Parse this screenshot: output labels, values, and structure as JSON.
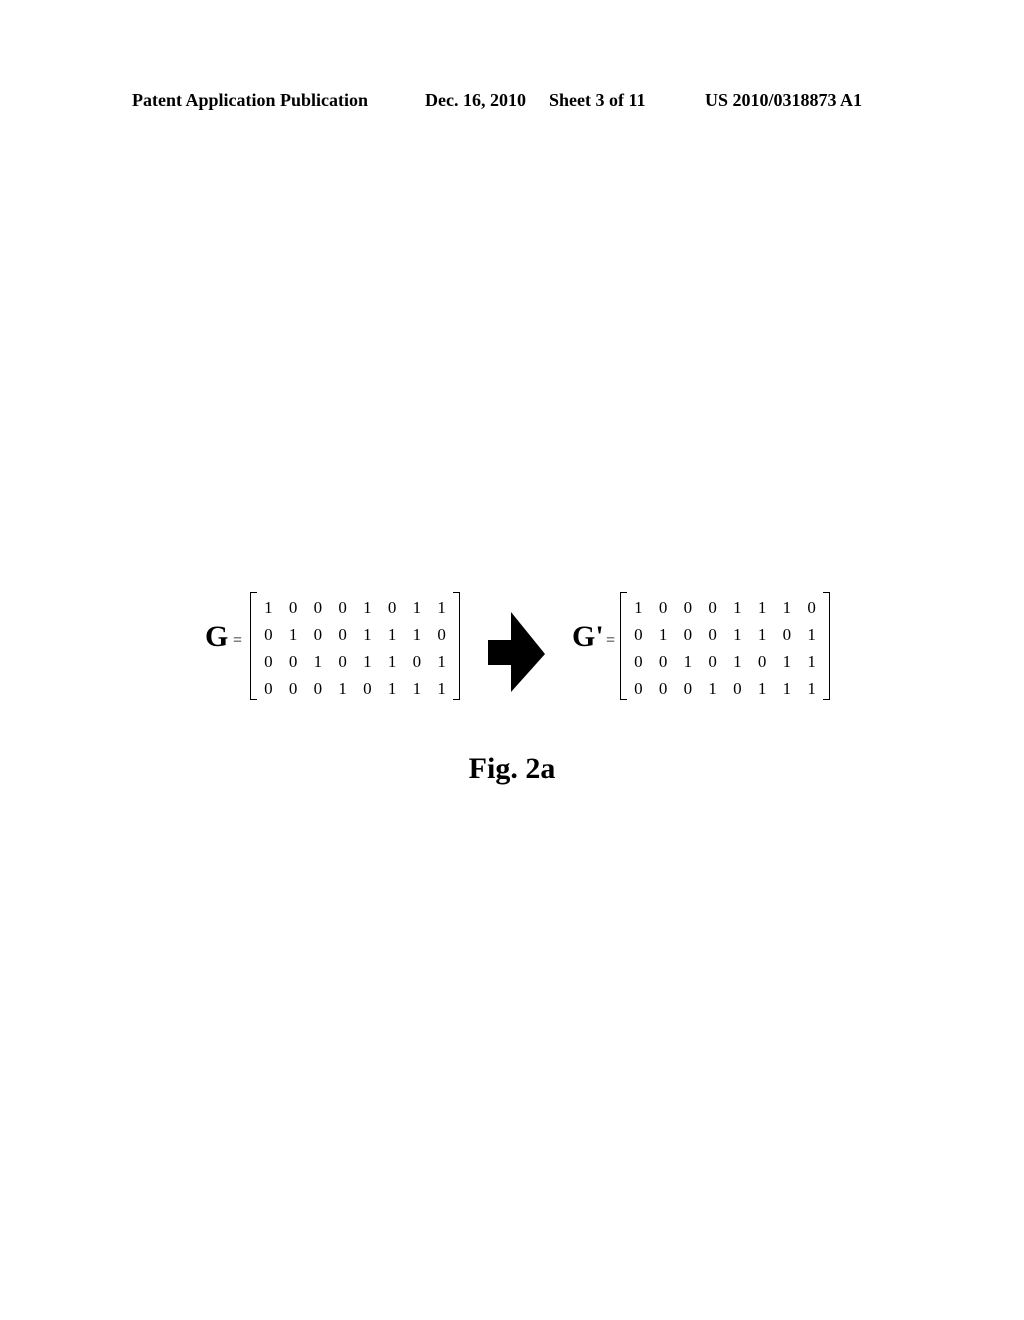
{
  "header": {
    "publication": "Patent Application Publication",
    "date": "Dec. 16, 2010",
    "sheet": "Sheet 3 of 11",
    "number": "US 2010/0318873 A1"
  },
  "figure": {
    "caption": "Fig. 2a",
    "arrow_icon": "right-arrow-icon",
    "matrix_g": {
      "label": "G",
      "equals": "=",
      "rows": [
        [
          "1",
          "0",
          "0",
          "0",
          "1",
          "0",
          "1",
          "1"
        ],
        [
          "0",
          "1",
          "0",
          "0",
          "1",
          "1",
          "1",
          "0"
        ],
        [
          "0",
          "0",
          "1",
          "0",
          "1",
          "1",
          "0",
          "1"
        ],
        [
          "0",
          "0",
          "0",
          "1",
          "0",
          "1",
          "1",
          "1"
        ]
      ]
    },
    "matrix_g_prime": {
      "label": "G'",
      "equals": "=",
      "rows": [
        [
          "1",
          "0",
          "0",
          "0",
          "1",
          "1",
          "1",
          "0"
        ],
        [
          "0",
          "1",
          "0",
          "0",
          "1",
          "1",
          "0",
          "1"
        ],
        [
          "0",
          "0",
          "1",
          "0",
          "1",
          "0",
          "1",
          "1"
        ],
        [
          "0",
          "0",
          "0",
          "1",
          "0",
          "1",
          "1",
          "1"
        ]
      ]
    }
  }
}
